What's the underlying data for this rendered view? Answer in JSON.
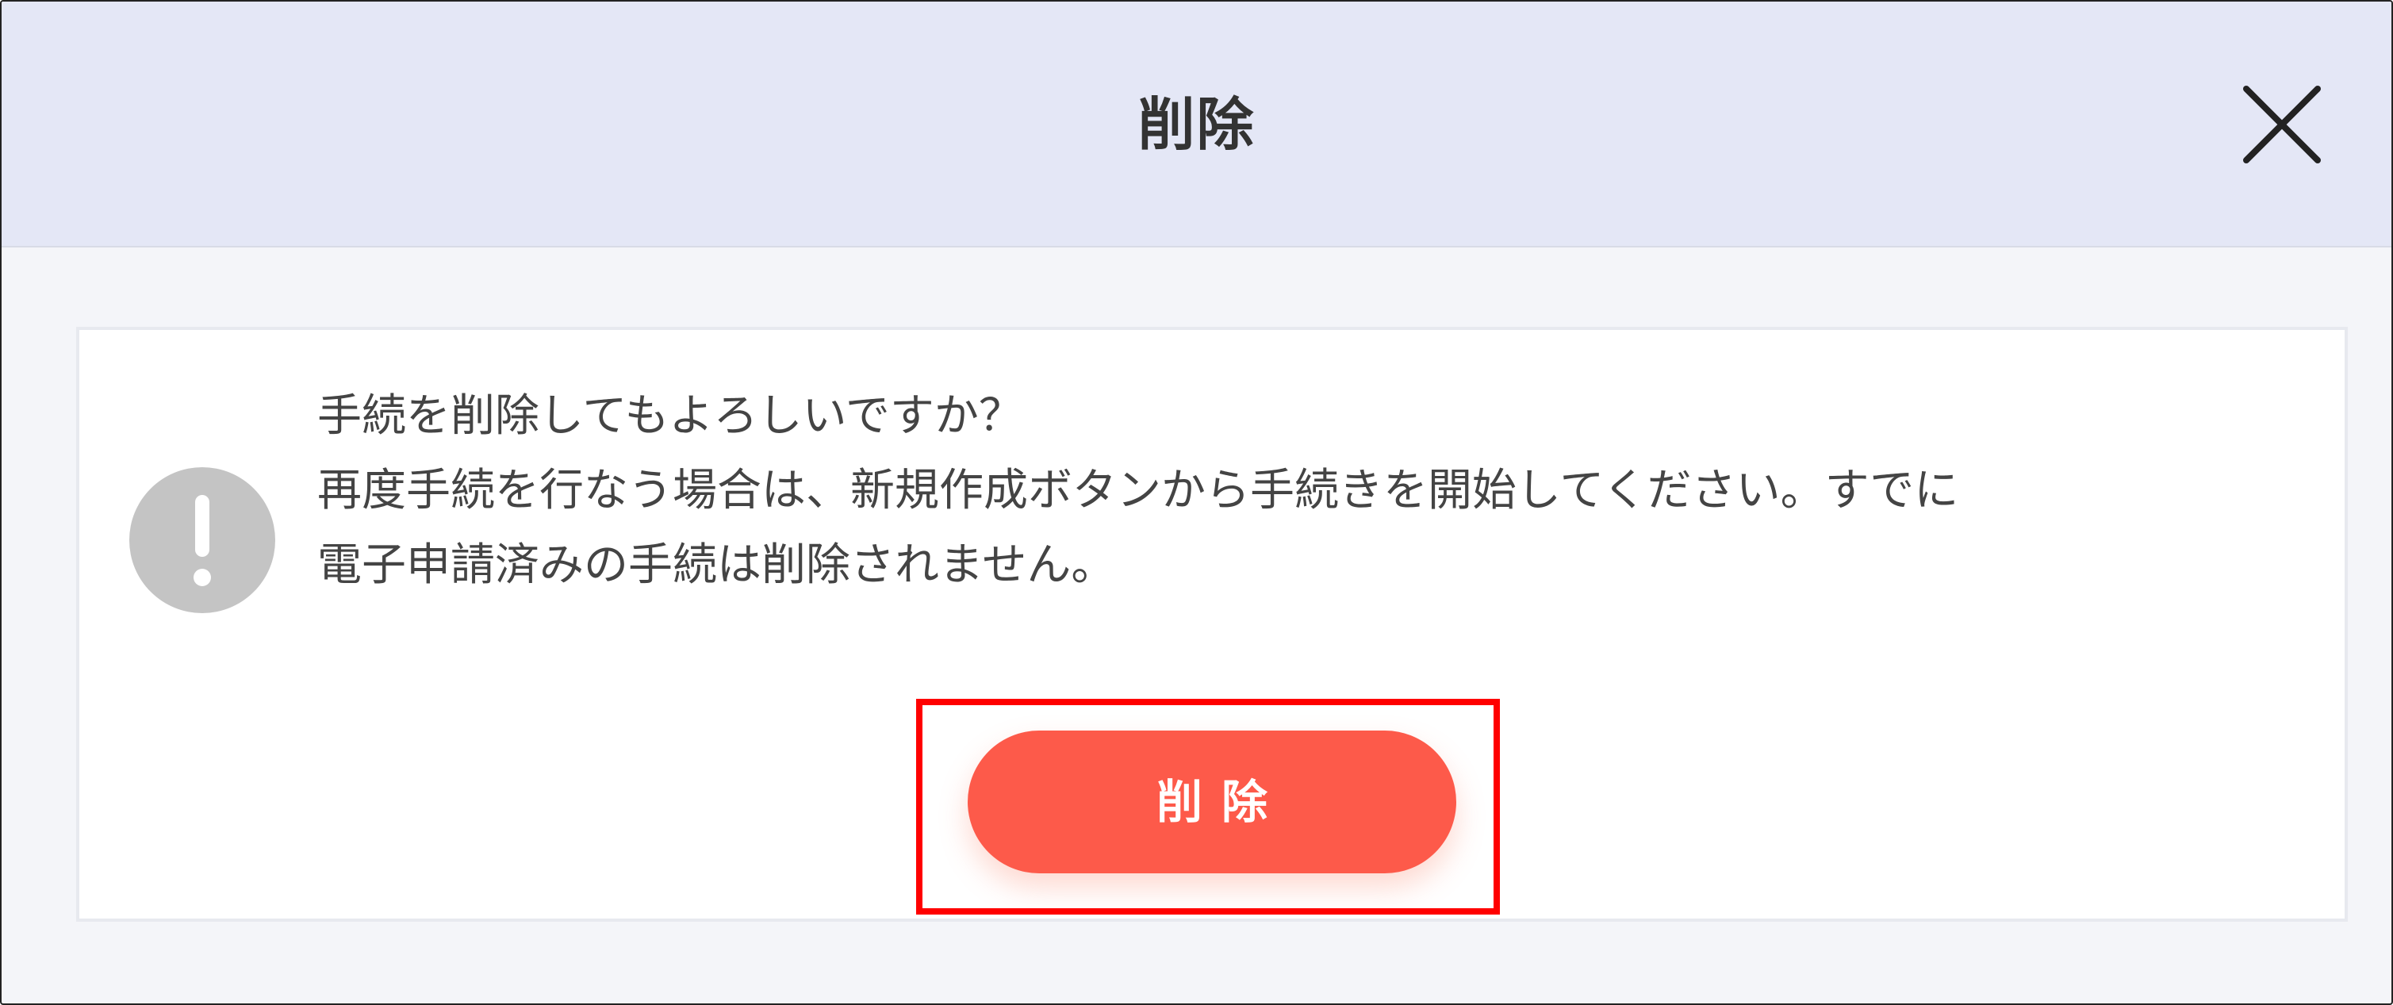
{
  "dialog": {
    "title": "削除",
    "close_icon": "close-icon",
    "warning_icon": "exclamation-circle-icon",
    "message_lines": [
      "手続を削除してもよろしいですか？",
      "再度手続を行なう場合は、新規作成ボタンから手続きを開始してください。すでに",
      "電子申請済みの手続は削除されません。"
    ],
    "delete_button_label": "削除"
  },
  "colors": {
    "header_bg": "#e4e7f6",
    "body_bg": "#f4f5f9",
    "card_bg": "#ffffff",
    "accent": "#fd5a4a",
    "highlight": "#ff0000",
    "icon_gray": "#c4c4c4"
  }
}
